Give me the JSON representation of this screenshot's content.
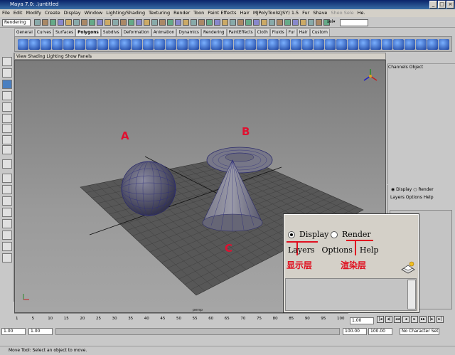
{
  "window": {
    "title": "Maya 7.0: .\\untitled"
  },
  "menubar": {
    "items": [
      "File",
      "Edit",
      "Modify",
      "Create",
      "Display",
      "Window",
      "Lighting/Shading",
      "Texturing",
      "Render",
      "Toon",
      "Paint Effects",
      "Hair",
      "MJPolyTools(JSY) 1.5",
      "Fur",
      "Shave",
      "Sheo Sele",
      "He."
    ]
  },
  "statusline": {
    "menuset": "Rendering",
    "sel_label": "sel▾"
  },
  "shelf": {
    "tabs": [
      "General",
      "Curves",
      "Surfaces",
      "Polygons",
      "Subdivs",
      "Deformation",
      "Animation",
      "Dynamics",
      "Rendering",
      "PaintEffects",
      "Cloth",
      "Fluids",
      "Fur",
      "Hair",
      "Custom"
    ],
    "active_tab": "Polygons"
  },
  "viewport": {
    "menu": "View Shading Lighting Show Panels",
    "footer_label": "persp"
  },
  "annotations": {
    "a": "A",
    "b": "B",
    "c": "C"
  },
  "channelbox": {
    "menu": "Channels Object"
  },
  "layer_editor_small": {
    "display": "Display",
    "render": "Render",
    "menu": "Layers Options Help"
  },
  "layer_editor_zoom": {
    "display": "Display",
    "render": "Render",
    "menu": [
      "Layers",
      "Options",
      "Help"
    ],
    "display_cn": "显示层",
    "render_cn": "渲染层"
  },
  "timeslider": {
    "ticks": [
      "1",
      "5",
      "10",
      "15",
      "20",
      "25",
      "30",
      "35",
      "40",
      "45",
      "50",
      "55",
      "60",
      "65",
      "70",
      "75",
      "80",
      "85",
      "90",
      "95",
      "100"
    ],
    "current_time": "1.00"
  },
  "rangeslider": {
    "start": "1.00",
    "inner_start": "1.00",
    "inner_end": "100.00",
    "end": "100.00",
    "charset": "No Character Set"
  },
  "helpline": {
    "text": "Move Tool: Select an object to move."
  },
  "colors": {
    "annotation": "#e01020",
    "active_tool": "#4a7fc0"
  }
}
